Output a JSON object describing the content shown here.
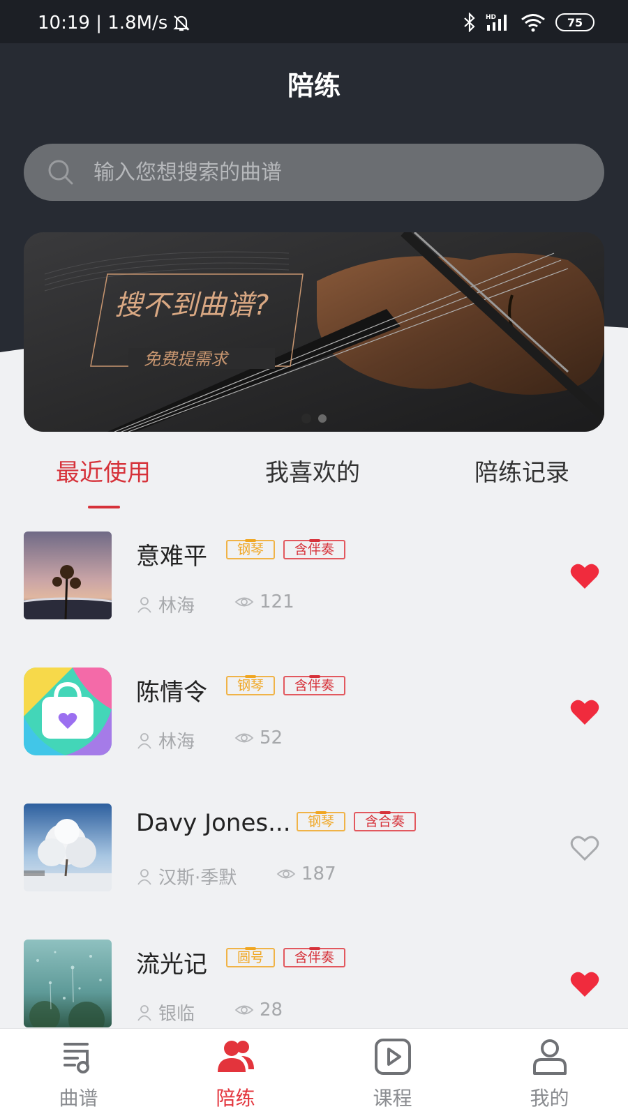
{
  "status_bar": {
    "time": "10:19 | 1.8M/s",
    "battery": "75"
  },
  "header": {
    "title": "陪练"
  },
  "search": {
    "placeholder": "输入您想搜索的曲谱"
  },
  "banner": {
    "headline": "搜不到曲谱?",
    "subline": "免费提需求",
    "page_count": 2,
    "active_page": 1
  },
  "tabs": [
    {
      "label": "最近使用",
      "active": true
    },
    {
      "label": "我喜欢的",
      "active": false
    },
    {
      "label": "陪练记录",
      "active": false
    }
  ],
  "items": [
    {
      "title": "意难平",
      "tags": [
        "钢琴",
        "含伴奏"
      ],
      "author": "林海",
      "views": "121",
      "liked": true,
      "thumb": "sunset-flower"
    },
    {
      "title": "陈情令",
      "tags": [
        "钢琴",
        "含伴奏"
      ],
      "author": "林海",
      "views": "52",
      "liked": true,
      "thumb": "shopping-bag-app"
    },
    {
      "title": "Davy Jones...",
      "tags": [
        "钢琴",
        "含合奏"
      ],
      "author": "汉斯·季默",
      "views": "187",
      "liked": false,
      "thumb": "frosted-tree"
    },
    {
      "title": "流光记",
      "tags": [
        "圆号",
        "含伴奏"
      ],
      "author": "银临",
      "views": "28",
      "liked": true,
      "thumb": "rain-window"
    }
  ],
  "bottom_nav": [
    {
      "label": "曲谱",
      "icon": "music-score-icon",
      "active": false
    },
    {
      "label": "陪练",
      "icon": "people-icon",
      "active": true
    },
    {
      "label": "课程",
      "icon": "play-icon",
      "active": false
    },
    {
      "label": "我的",
      "icon": "user-icon",
      "active": false
    }
  ],
  "colors": {
    "accent": "#d6323a",
    "header_bg": "#272b33",
    "tag_orange": "#f0a622",
    "heart": "#f02b3d"
  }
}
